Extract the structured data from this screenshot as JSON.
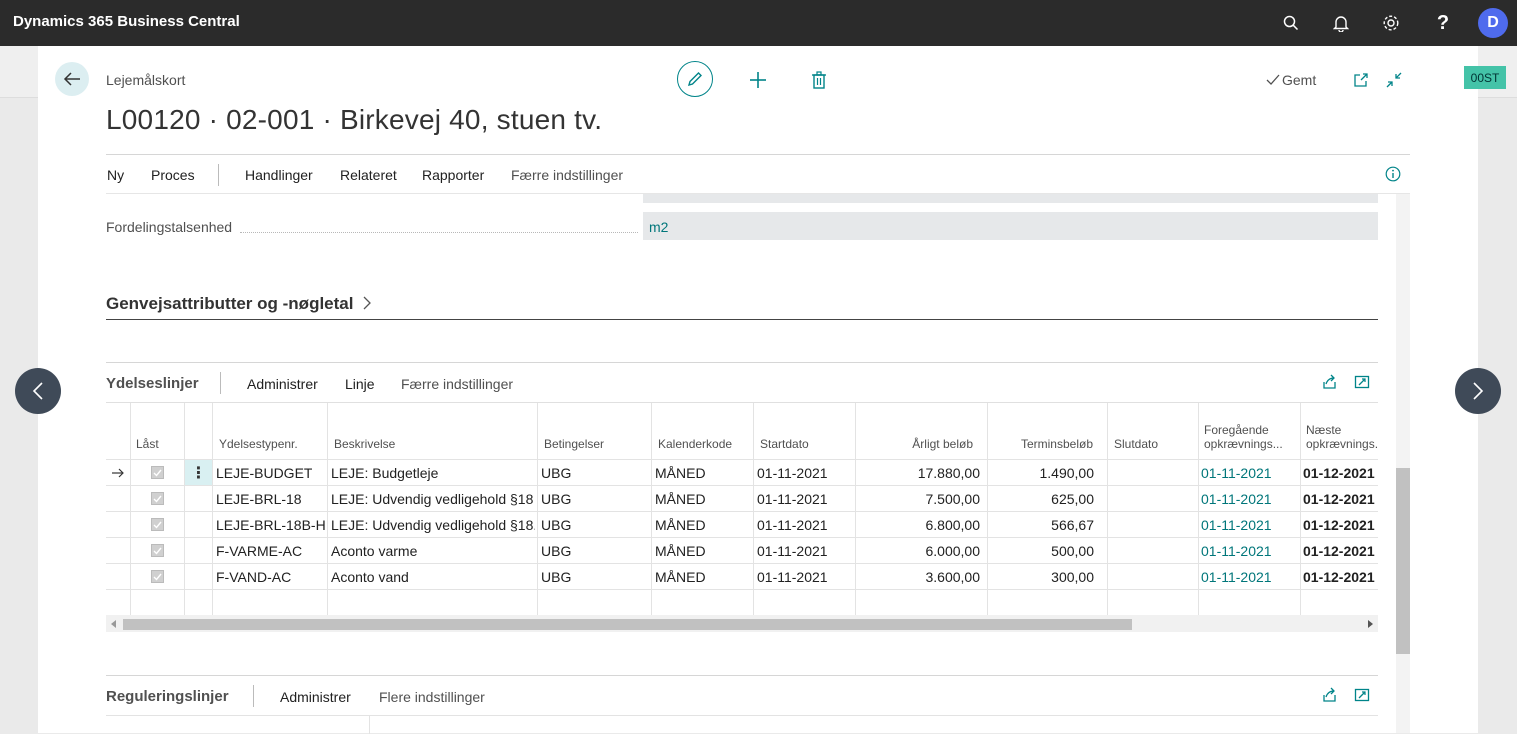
{
  "app": {
    "title": "Dynamics 365 Business Central",
    "avatar_initial": "D"
  },
  "header": {
    "page_type": "Lejemålskort",
    "title": "L00120 · 02-001 · Birkevej 40, stuen tv.",
    "saved_label": "Gemt",
    "badge": "00ST"
  },
  "actions": [
    {
      "label": "Ny"
    },
    {
      "label": "Proces"
    },
    {
      "label": "Handlinger"
    },
    {
      "label": "Relateret"
    },
    {
      "label": "Rapporter"
    },
    {
      "label": "Færre indstillinger"
    }
  ],
  "field": {
    "label": "Fordelingstalsenhed",
    "value": "m2"
  },
  "fasttab": {
    "title": "Genvejsattributter og -nøgletal"
  },
  "ydelseslinjer": {
    "title": "Ydelseslinjer",
    "actions": [
      "Administrer",
      "Linje",
      "Færre indstillinger"
    ],
    "columns": {
      "locked": "Låst",
      "type_no": "Ydelsestypenr.",
      "description": "Beskrivelse",
      "terms": "Betingelser",
      "calendar": "Kalenderkode",
      "start": "Startdato",
      "annual": "Årligt beløb",
      "term_amount": "Terminsbeløb",
      "end": "Slutdato",
      "prev_1": "Foregående",
      "prev_2": "opkrævnings...",
      "next_1": "Næste",
      "next_2": "opkrævnings..."
    },
    "rows": [
      {
        "type_no": "LEJE-BUDGET",
        "description": "LEJE: Budgetleje",
        "terms": "UBG",
        "calendar": "MÅNED",
        "start": "01-11-2021",
        "annual": "17.880,00",
        "term_amount": "1.490,00",
        "end": "",
        "prev": "01-11-2021",
        "next": "01-12-2021"
      },
      {
        "type_no": "LEJE-BRL-18",
        "description": "LEJE: Udvendig vedligehold §18",
        "terms": "UBG",
        "calendar": "MÅNED",
        "start": "01-11-2021",
        "annual": "7.500,00",
        "term_amount": "625,00",
        "end": "",
        "prev": "01-11-2021",
        "next": "01-12-2021"
      },
      {
        "type_no": "LEJE-BRL-18B-H",
        "description": "LEJE: Udvendig vedligehold §18...",
        "terms": "UBG",
        "calendar": "MÅNED",
        "start": "01-11-2021",
        "annual": "6.800,00",
        "term_amount": "566,67",
        "end": "",
        "prev": "01-11-2021",
        "next": "01-12-2021"
      },
      {
        "type_no": "F-VARME-AC",
        "description": "Aconto varme",
        "terms": "UBG",
        "calendar": "MÅNED",
        "start": "01-11-2021",
        "annual": "6.000,00",
        "term_amount": "500,00",
        "end": "",
        "prev": "01-11-2021",
        "next": "01-12-2021"
      },
      {
        "type_no": "F-VAND-AC",
        "description": "Aconto vand",
        "terms": "UBG",
        "calendar": "MÅNED",
        "start": "01-11-2021",
        "annual": "3.600,00",
        "term_amount": "300,00",
        "end": "",
        "prev": "01-11-2021",
        "next": "01-12-2021"
      }
    ]
  },
  "reguleringslinjer": {
    "title": "Reguleringslinjer",
    "actions": [
      "Administrer",
      "Flere indstillinger"
    ]
  },
  "colors": {
    "topbar": "#2b2b2b",
    "accent": "#008489",
    "link": "#00767a",
    "badge": "#44c3a8",
    "avatar": "#4f6bed"
  }
}
